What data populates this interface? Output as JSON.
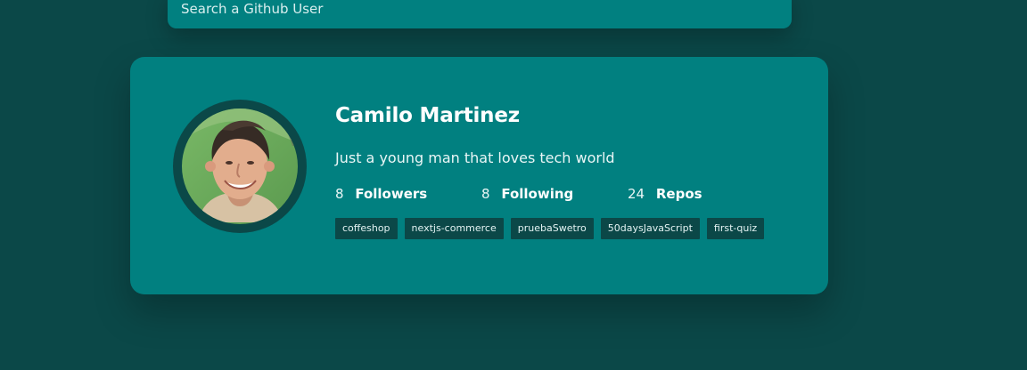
{
  "search": {
    "placeholder": "Search a Github User"
  },
  "profile": {
    "name": "Camilo Martinez",
    "bio": "Just a young man that loves tech world",
    "stats": [
      {
        "value": "8",
        "label": "Followers"
      },
      {
        "value": "8",
        "label": "Following"
      },
      {
        "value": "24",
        "label": "Repos"
      }
    ],
    "repos": [
      "coffeshop",
      "nextjs-commerce",
      "pruebaSwetro",
      "50daysJavaScript",
      "first-quiz"
    ]
  },
  "colors": {
    "background": "#0b4848",
    "card": "#018080",
    "tag": "#0b4848",
    "text": "#ffffff"
  },
  "icons": {
    "avatar": "user-photo-avatar"
  }
}
